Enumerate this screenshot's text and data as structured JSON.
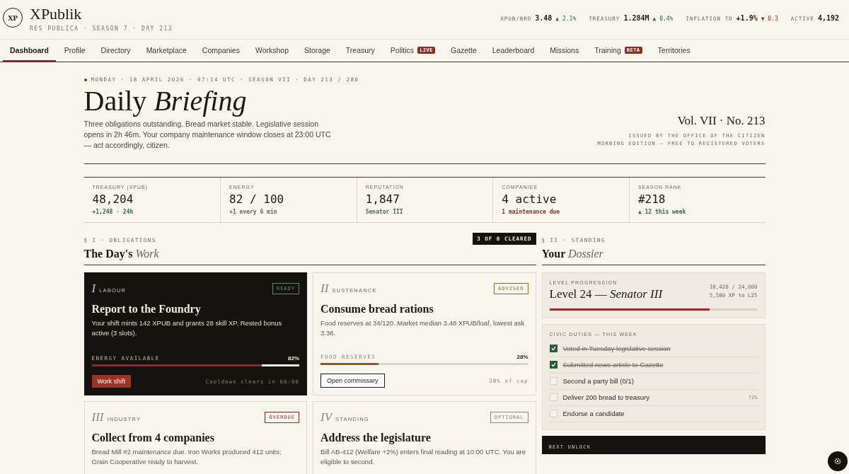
{
  "brand": {
    "logo": "XP",
    "name": "XPublik",
    "tagline": "RES PUBLICA · SEASON 7 · DAY 213"
  },
  "ticker": [
    {
      "label": "XPUB/BRD",
      "value": "3.48",
      "change": "▲ 2.1%",
      "color": "#2f6b48"
    },
    {
      "label": "TREASURY",
      "value": "1.284M",
      "change": "▲ 0.4%",
      "color": "#2f6b48"
    },
    {
      "label": "INFLATION 7D",
      "value": "+1.9%",
      "change": "▼ 0.3",
      "color": "#8e2b22"
    },
    {
      "label": "ACTIVE",
      "value": "4,192"
    }
  ],
  "tabs": [
    {
      "label": "Dashboard",
      "selected": true
    },
    {
      "label": "Profile",
      "selected": false
    },
    {
      "label": "Directory",
      "selected": false
    },
    {
      "label": "Marketplace",
      "selected": false
    },
    {
      "label": "Companies",
      "selected": false
    },
    {
      "label": "Workshop",
      "selected": false
    },
    {
      "label": "Storage",
      "selected": false
    },
    {
      "label": "Treasury",
      "selected": false
    },
    {
      "label": "Politics",
      "selected": false,
      "badge": "LIVE"
    },
    {
      "label": "Gazette",
      "selected": false
    },
    {
      "label": "Leaderboard",
      "selected": false
    },
    {
      "label": "Missions",
      "selected": false
    },
    {
      "label": "Training",
      "selected": false,
      "badge": "BETA"
    },
    {
      "label": "Territories",
      "selected": false
    }
  ],
  "briefing": {
    "dateline": "MONDAY · 18 APRIL 2026 · 07:14 UTC · SEASON VII · DAY 213 / 280",
    "title": "Daily",
    "title_italic": "Briefing",
    "summary": "Three obligations outstanding. Bread market stable. Legislative session opens in 2h 46m. Your company maintenance window closes at 23:00 UTC — act accordingly, citizen.",
    "volume": "Vol. VII · No. 213",
    "issuer": "ISSUED BY THE OFFICE OF THE CITIZEN",
    "edition": "MORNING EDITION — FREE TO REGISTERED VOTERS"
  },
  "stats": [
    {
      "label": "TREASURY (XPUB)",
      "value": "48,204",
      "note": "+1,248 · 24h",
      "color": "#2f6b48"
    },
    {
      "label": "ENERGY",
      "value": "82 / 100",
      "note": "+1 every 6 min",
      "color": "#6b655c"
    },
    {
      "label": "REPUTATION",
      "value": "1,847",
      "note": "Senator III",
      "color": "#4e6a5a"
    },
    {
      "label": "COMPANIES",
      "value": "4 active",
      "note": "1 maintenance due",
      "color": "#8e2b22"
    },
    {
      "label": "SEASON RANK",
      "value": "#218",
      "note": "▲ 12 this week",
      "color": "#2f6b48"
    }
  ],
  "obligations": {
    "section": "§ I · OBLIGATIONS",
    "title": "The Day's",
    "title_italic": "Work",
    "progress": "3 OF 8 CLEARED",
    "cards": [
      {
        "kind": "featured",
        "numeral": "I",
        "category": "LABOUR",
        "color": "#5f8a6a",
        "status_label": "READY",
        "title": "Report to the Foundry",
        "body": "Your shift mints 142 XPUB and grants 28 skill XP. Rested bonus active (3 slots).",
        "meter": {
          "label": "ENERGY AVAILABLE",
          "reading": "82%",
          "level": 0.82
        },
        "action": {
          "label": "Work shift"
        },
        "note": "Cooldown clears in 00:00"
      },
      {
        "kind": "normal",
        "numeral": "II",
        "category": "SUSTENANCE",
        "color": "#8a6a30",
        "status_label": "ADVISED",
        "title": "Consume bread rations",
        "body": "Food reserves at 34/120. Market median 3.48 XPUB/loaf, lowest ask 3.36.",
        "meter": {
          "label": "FOOD RESERVES",
          "reading": "28%",
          "level": 0.28
        },
        "action": {
          "label": "Open commissary"
        },
        "note": "28% of cap"
      },
      {
        "kind": "normal",
        "numeral": "III",
        "category": "INDUSTRY",
        "color": "#8e2b22",
        "status_label": "OVERDUE",
        "title": "Collect from 4 companies",
        "body": "Bread Mill #2 maintenance due. Iron Works produced 412 units; Grain Cooperative ready to harvest."
      },
      {
        "kind": "normal",
        "numeral": "IV",
        "category": "STANDING",
        "color": "#8a847a",
        "status_label": "OPTIONAL",
        "title": "Address the legislature",
        "body": "Bill AB-412 (Welfare +2%) enters final reading at 10:00 UTC. You are eligible to second."
      }
    ]
  },
  "dossier": {
    "section": "§ II · STANDING",
    "title": "Your",
    "title_italic": "Dossier",
    "level": {
      "label": "LEVEL PROGRESSION",
      "title": "Level 24 —",
      "title_italic": "Senator III",
      "xp": "18,420 / 24,000",
      "remaining": "5,580 XP to L25",
      "level": 0.77
    },
    "duties_title": "CIVIC DUTIES — THIS WEEK",
    "duties": [
      {
        "label": "Voted in Tuesday legislative session",
        "checked": true
      },
      {
        "label": "Submitted news article to Gazette",
        "checked": true
      },
      {
        "label": "Second a party bill (0/1)",
        "checked": false
      },
      {
        "label": "Deliver 200 bread to treasury",
        "checked": false,
        "note": "72%"
      },
      {
        "label": "Endorse a candidate",
        "checked": false
      }
    ],
    "next_unlock": "NEXT UNLOCK"
  }
}
